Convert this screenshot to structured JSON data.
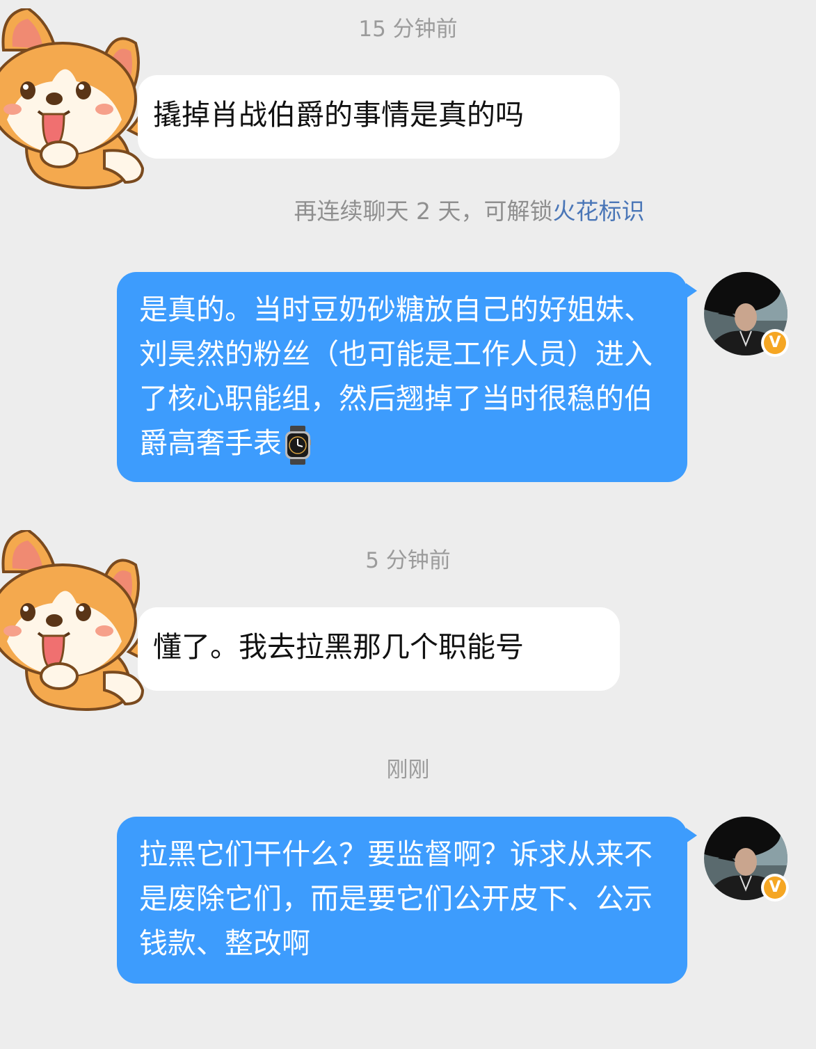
{
  "chat": {
    "messages": [
      {
        "type": "timestamp",
        "text": "15 分钟前"
      },
      {
        "type": "incoming",
        "sender_avatar": "corgi-sticker-avatar",
        "text": "撬掉肖战伯爵的事情是真的吗"
      },
      {
        "type": "system",
        "text": "再连续聊天 2 天，可解锁",
        "link_text": "火花标识"
      },
      {
        "type": "outgoing",
        "sender_avatar": "verified-user-avatar",
        "text": "是真的。当时豆奶砂糖放自己的好姐妹、刘昊然的粉丝（也可能是工作人员）进入了核心职能组，然后翘掉了当时很稳的伯爵高奢手表",
        "emoji": "watch-emoji"
      },
      {
        "type": "timestamp",
        "text": "5 分钟前"
      },
      {
        "type": "incoming",
        "sender_avatar": "corgi-sticker-avatar",
        "text": "懂了。我去拉黑那几个职能号"
      },
      {
        "type": "timestamp",
        "text": "刚刚"
      },
      {
        "type": "outgoing",
        "sender_avatar": "verified-user-avatar",
        "text": "拉黑它们干什么？要监督啊？诉求从来不是废除它们，而是要它们公开皮下、公示钱款、整改啊"
      }
    ]
  },
  "colors": {
    "background": "#ededed",
    "incoming_bubble": "#ffffff",
    "outgoing_bubble": "#3d9cfd",
    "timestamp_text": "#9b9b9b",
    "link_text": "#4a76b7",
    "verified_badge": "#f5a623"
  },
  "badge": {
    "glyph": "V"
  }
}
